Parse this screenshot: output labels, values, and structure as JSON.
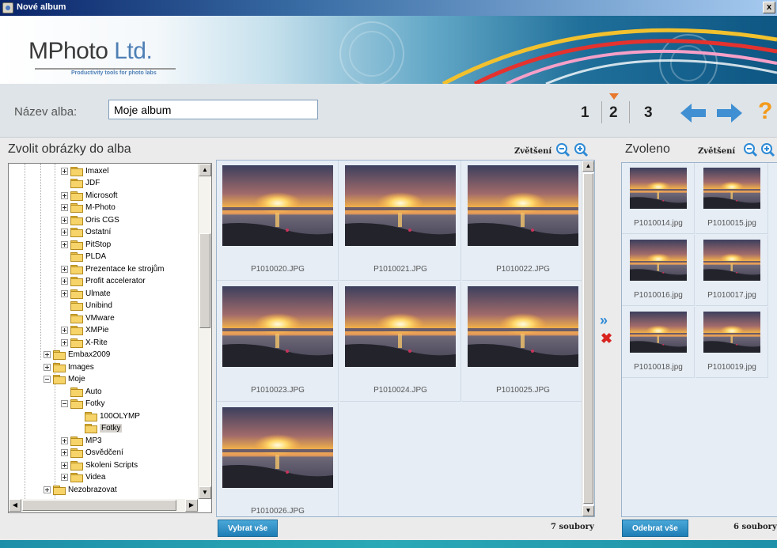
{
  "window": {
    "title": "Nové album",
    "close_label": "x"
  },
  "logo": {
    "name_part1": "MPhoto",
    "name_part2": "Ltd.",
    "tagline": "Productivity tools for photo labs"
  },
  "album": {
    "name_label": "Název alba:",
    "name_value": "Moje album"
  },
  "steps": {
    "items": [
      "1",
      "2",
      "3"
    ],
    "current": "2",
    "help": "?"
  },
  "left_panel": {
    "title": "Zvolit obrázky do alba",
    "zoom_label": "Zvětšení",
    "tree": [
      {
        "label": "Imaxel",
        "exp": "plus",
        "level": 3
      },
      {
        "label": "JDF",
        "exp": "none",
        "level": 3
      },
      {
        "label": "Microsoft",
        "exp": "plus",
        "level": 3
      },
      {
        "label": "M-Photo",
        "exp": "plus",
        "level": 3
      },
      {
        "label": "Oris CGS",
        "exp": "plus",
        "level": 3
      },
      {
        "label": "Ostatní",
        "exp": "plus",
        "level": 3
      },
      {
        "label": "PitStop",
        "exp": "plus",
        "level": 3
      },
      {
        "label": "PLDA",
        "exp": "none",
        "level": 3
      },
      {
        "label": "Prezentace ke strojům",
        "exp": "plus",
        "level": 3
      },
      {
        "label": "Profit accelerator",
        "exp": "plus",
        "level": 3
      },
      {
        "label": "Ulmate",
        "exp": "plus",
        "level": 3
      },
      {
        "label": "Unibind",
        "exp": "none",
        "level": 3
      },
      {
        "label": "VMware",
        "exp": "none",
        "level": 3
      },
      {
        "label": "XMPie",
        "exp": "plus",
        "level": 3
      },
      {
        "label": "X-Rite",
        "exp": "plus",
        "level": 3
      },
      {
        "label": "Embax2009",
        "exp": "plus",
        "level": 2
      },
      {
        "label": "Images",
        "exp": "plus",
        "level": 2
      },
      {
        "label": "Moje",
        "exp": "minus",
        "level": 2
      },
      {
        "label": "Auto",
        "exp": "none",
        "level": 3
      },
      {
        "label": "Fotky",
        "exp": "minus",
        "level": 3
      },
      {
        "label": "100OLYMP",
        "exp": "none",
        "level": 4
      },
      {
        "label": "Fotky",
        "exp": "none",
        "level": 4,
        "selected": true
      },
      {
        "label": "MP3",
        "exp": "plus",
        "level": 3
      },
      {
        "label": "Osvědčení",
        "exp": "plus",
        "level": 3
      },
      {
        "label": "Skoleni Scripts",
        "exp": "plus",
        "level": 3
      },
      {
        "label": "Videa",
        "exp": "plus",
        "level": 3
      },
      {
        "label": "Nezobrazovat",
        "exp": "plus",
        "level": 2
      }
    ],
    "photos": [
      "P1010020.JPG",
      "P1010021.JPG",
      "P1010022.JPG",
      "P1010023.JPG",
      "P1010024.JPG",
      "P1010025.JPG",
      "P1010026.JPG"
    ],
    "select_all": "Vybrat vše",
    "count": "7 soubory"
  },
  "transfer": {
    "add": "»",
    "remove": "✖"
  },
  "right_panel": {
    "title": "Zvoleno",
    "zoom_label": "Zvětšení",
    "photos": [
      "P1010014.jpg",
      "P1010015.jpg",
      "P1010016.jpg",
      "P1010017.jpg",
      "P1010018.jpg",
      "P1010019.jpg"
    ],
    "remove_all": "Odebrat vše",
    "count": "6 soubory"
  },
  "colors": {
    "accent_blue": "#1f7db6",
    "step_marker": "#e8782c",
    "help": "#f39a1a",
    "remove": "#d8231f"
  },
  "icons": [
    "zoom-out-icon",
    "zoom-in-icon",
    "arrow-left-icon",
    "arrow-right-icon",
    "help-icon",
    "folder-icon"
  ]
}
